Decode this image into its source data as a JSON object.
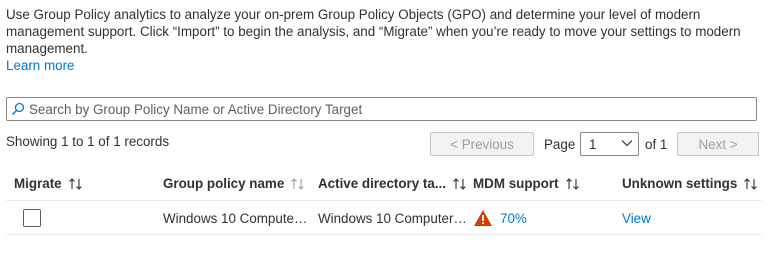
{
  "description": {
    "text": "Use Group Policy analytics to analyze your on-prem Group Policy Objects (GPO) and determine your level of modern management support. Click “Import” to begin the analysis, and “Migrate” when you’re ready to move your settings to modern management.",
    "learn_more": "Learn more"
  },
  "search": {
    "placeholder": "Search by Group Policy Name or Active Directory Target",
    "value": "",
    "icon": "search-icon"
  },
  "pagination": {
    "records": "Showing 1 to 1 of 1 records",
    "previous": "< Previous",
    "page_label": "Page",
    "page_value": "1",
    "of_label": "of 1",
    "next": "Next >"
  },
  "table": {
    "columns": [
      "Migrate",
      "Group policy name",
      "Active directory ta...",
      "MDM support",
      "Unknown settings"
    ],
    "rows": [
      {
        "migrate_checked": false,
        "group_policy_name": "Windows 10 Computer ...",
        "active_directory_target": "Windows 10 Computer ...",
        "mdm_support": "70%",
        "mdm_icon": "warning-icon",
        "unknown_settings": "View"
      }
    ]
  },
  "colors": {
    "accent": "#0078d4",
    "warning": "#d83b01",
    "text": "#323130",
    "disabled_text": "#a19f9d"
  }
}
